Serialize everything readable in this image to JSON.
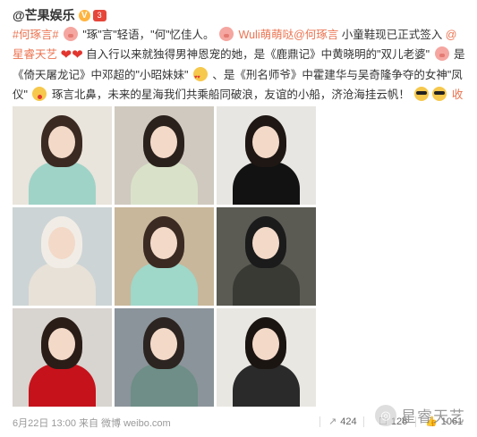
{
  "post": {
    "author": "@芒果娱乐",
    "badge_v": "V",
    "badge_level": "3",
    "segments": {
      "tag": "#何琢言#",
      "t1": "\"琢\"言\"轻语，\"何\"忆佳人。",
      "mention1": "Wuli萌萌哒@何琢言",
      "t2": " 小童鞋现已正式签入",
      "mention2": "@星睿天艺",
      "t3": "自入行以来就独得男神恩宠的她，是《鹿鼎记》中黄晓明的\"双儿老婆\"",
      "t4": "是《倚天屠龙记》中邓超的\"小昭妹妹\"",
      "t5": "、是《刑名师爷》中霍建华与吴奇隆争夺的女神\"凤仪\"",
      "t6": "琢言北鼻，未来的星海我们共乘船同破浪，友谊的小船，济沧海挂云帆！",
      "expand": "收起全文",
      "caret": "▲"
    }
  },
  "photos": [
    {
      "label": "photo-1",
      "bg": "#e9e4dc",
      "hair": "#3a2a22",
      "body": "#9fd3c7"
    },
    {
      "label": "photo-2",
      "bg": "#cfc9bf",
      "hair": "#2a211c",
      "body": "#d9e2c9"
    },
    {
      "label": "photo-3",
      "bg": "#e8e6e2",
      "hair": "#1e1714",
      "body": "#121212"
    },
    {
      "label": "photo-4",
      "bg": "#cdd4d6",
      "hair": "#f1ede6",
      "body": "#e7e1d8"
    },
    {
      "label": "photo-5",
      "bg": "#c8b79b",
      "hair": "#3a2a22",
      "body": "#9fd7c9"
    },
    {
      "label": "photo-6",
      "bg": "#5b5b54",
      "hair": "#1b1b1b",
      "body": "#3a3a35"
    },
    {
      "label": "photo-7",
      "bg": "#d8d4cf",
      "hair": "#2a1d18",
      "body": "#c6121b"
    },
    {
      "label": "photo-8",
      "bg": "#8b949a",
      "hair": "#2c2420",
      "body": "#6e8e87"
    },
    {
      "label": "photo-9",
      "bg": "#e9e7e2",
      "hair": "#1b1512",
      "body": "#2a2a2a"
    }
  ],
  "footer": {
    "time": "6月22日 13:00 来自 微博 weibo.com",
    "forward": "424",
    "comment": "126",
    "like": "1061",
    "forward_icon": "↗",
    "comment_icon": "☐",
    "like_icon": "👍"
  },
  "watermark": {
    "logo": "◎",
    "text": "星睿天艺"
  }
}
